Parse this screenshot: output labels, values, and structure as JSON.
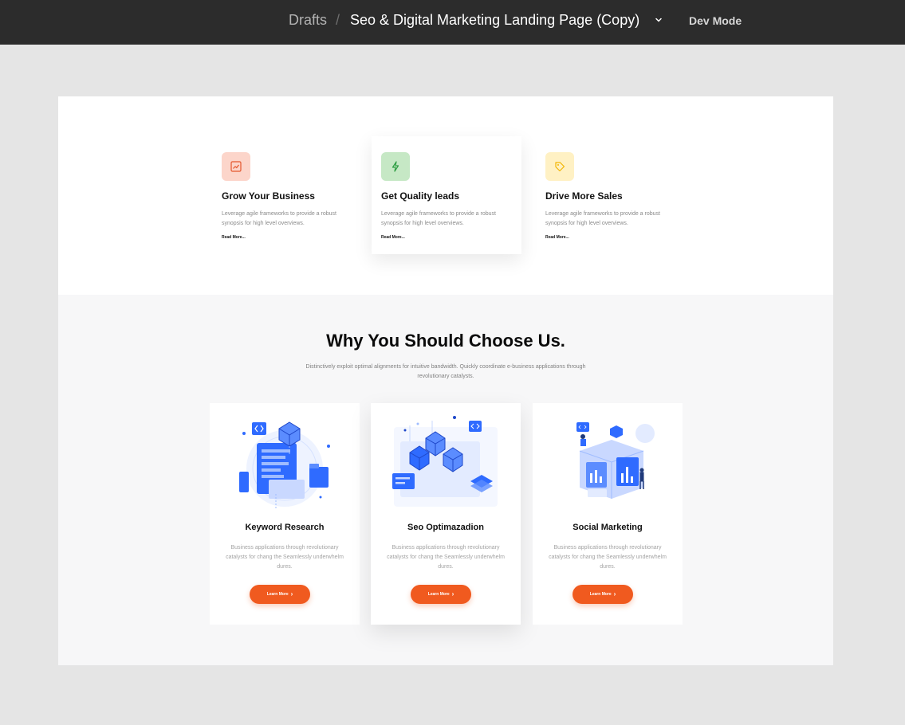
{
  "topbar": {
    "breadcrumb_parent": "Drafts",
    "separator": "/",
    "file_name": "Seo & Digital Marketing Landing Page (Copy)",
    "dev_mode": "Dev Mode"
  },
  "features": [
    {
      "title": "Grow Your Business",
      "description": "Leverage agile frameworks to provide a robust synopsis for high level overviews.",
      "link": "Read More...",
      "icon": "trend-chart-icon",
      "icon_bg": "#fcd5ca",
      "icon_color": "#e4572e"
    },
    {
      "title": "Get Quality leads",
      "description": "Leverage agile frameworks to provide a robust synopsis for high level overviews.",
      "link": "Read More...",
      "icon": "lightning-icon",
      "icon_bg": "#c6e8c5",
      "icon_color": "#2f9e44"
    },
    {
      "title": "Drive More Sales",
      "description": "Leverage agile frameworks to provide a robust synopsis for high level overviews.",
      "link": "Read More...",
      "icon": "tag-icon",
      "icon_bg": "#fff1c4",
      "icon_color": "#f2b705"
    }
  ],
  "why": {
    "title": "Why You Should Choose Us.",
    "subtitle": "Distinctively exploit optimal alignments for intuitive bandwidth. Quickly coordinate e-business applications through revolutionary catalysts."
  },
  "services": [
    {
      "title": "Keyword Research",
      "description": "Business applications through revolutionary catalysts for chang the Seamlessly underwhelm dures.",
      "button": "Learn More",
      "illustration": "keyword-research-illustration"
    },
    {
      "title": "Seo Optimazadion",
      "description": "Business applications through revolutionary catalysts for chang the Seamlessly underwhelm dures.",
      "button": "Learn More",
      "illustration": "seo-optimization-illustration"
    },
    {
      "title": "Social Marketing",
      "description": "Business applications through revolutionary catalysts for chang the Seamlessly underwhelm dures.",
      "button": "Learn More",
      "illustration": "social-marketing-illustration"
    }
  ],
  "colors": {
    "topbar": "#2c2c2c",
    "accent": "#f05a1f",
    "illustration_blue": "#2f6bff"
  }
}
